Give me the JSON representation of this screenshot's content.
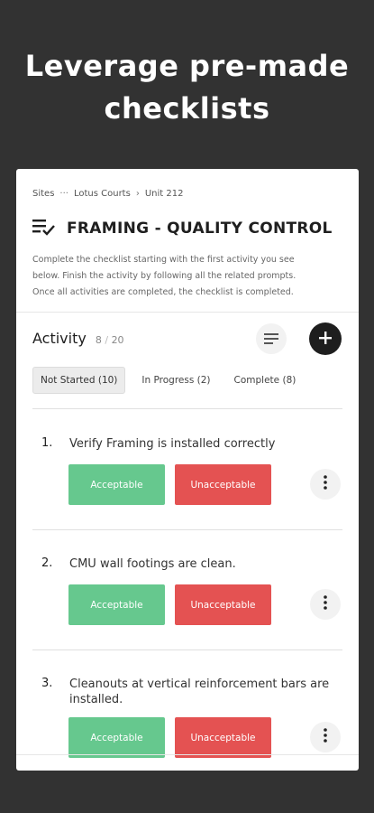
{
  "promo": {
    "headline_line1": "Leverage pre-made",
    "headline_line2": "checklists"
  },
  "breadcrumb": {
    "items": [
      "Sites",
      "Lotus Courts",
      "Unit 212"
    ],
    "separator_1": "···",
    "separator_2": "›"
  },
  "header": {
    "title": "FRAMING - QUALITY CONTROL",
    "description_line1": "Complete the checklist starting with the first activity you see",
    "description_line2": "below. Finish the activity by following all the related prompts.",
    "description_line3": "Once all activities are completed, the checklist is completed."
  },
  "activity": {
    "label": "Activity",
    "count": "8",
    "slash": "/",
    "total": "20"
  },
  "tabs": [
    {
      "label": "Not Started (10)"
    },
    {
      "label": "In Progress (2)"
    },
    {
      "label": "Complete (8)"
    }
  ],
  "items": [
    {
      "number": "1.",
      "text": "Verify Framing is installed correctly",
      "accept": "Acceptable",
      "reject": "Unacceptable"
    },
    {
      "number": "2.",
      "text": "CMU wall footings are clean.",
      "accept": "Acceptable",
      "reject": "Unacceptable"
    },
    {
      "number": "3.",
      "text": "Cleanouts at vertical reinforcement bars are installed.",
      "accept": "Acceptable",
      "reject": "Unacceptable"
    }
  ],
  "colors": {
    "accept": "#66c88e",
    "reject": "#e45252",
    "background": "#323232"
  },
  "icons": {
    "title": "checklist-icon",
    "filter": "filter-icon",
    "add": "plus-icon",
    "more": "more-vertical-icon"
  }
}
